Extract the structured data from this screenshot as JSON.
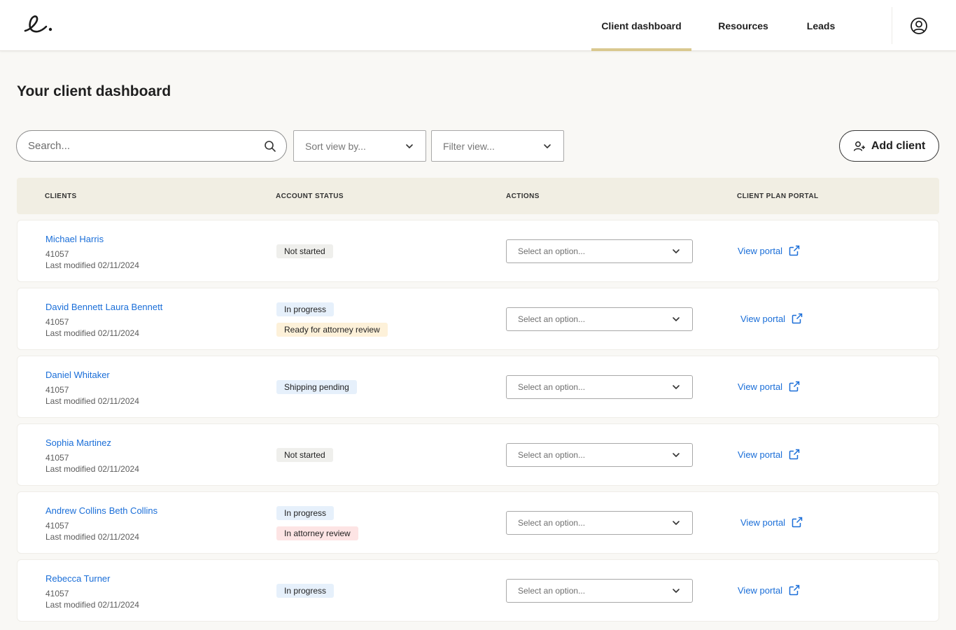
{
  "header": {
    "nav": [
      {
        "label": "Client dashboard",
        "active": true
      },
      {
        "label": "Resources",
        "active": false
      },
      {
        "label": "Leads",
        "active": false
      }
    ]
  },
  "page": {
    "title": "Your client dashboard"
  },
  "toolbar": {
    "search_placeholder": "Search...",
    "sort_placeholder": "Sort view by...",
    "filter_placeholder": "Filter view...",
    "add_client_label": "Add client"
  },
  "table": {
    "headers": [
      "CLIENTS",
      "ACCOUNT STATUS",
      "ACTIONS",
      "CLIENT PLAN PORTAL"
    ],
    "action_placeholder": "Select an option...",
    "portal_label": "View portal",
    "rows": [
      {
        "names": [
          "Michael Harris"
        ],
        "id": "41057",
        "modified": "Last modified 02/11/2024",
        "statuses": [
          {
            "label": "Not started",
            "tone": "gray"
          }
        ]
      },
      {
        "names": [
          "David Bennett",
          "Laura Bennett"
        ],
        "id": "41057",
        "modified": "Last modified 02/11/2024",
        "statuses": [
          {
            "label": "In progress",
            "tone": "blue"
          },
          {
            "label": "Ready for attorney review",
            "tone": "yellow"
          }
        ]
      },
      {
        "names": [
          "Daniel Whitaker"
        ],
        "id": "41057",
        "modified": "Last modified 02/11/2024",
        "statuses": [
          {
            "label": "Shipping pending",
            "tone": "blue"
          }
        ]
      },
      {
        "names": [
          "Sophia Martinez"
        ],
        "id": "41057",
        "modified": "Last modified 02/11/2024",
        "statuses": [
          {
            "label": "Not started",
            "tone": "gray"
          }
        ]
      },
      {
        "names": [
          "Andrew Collins",
          "Beth Collins"
        ],
        "id": "41057",
        "modified": "Last modified 02/11/2024",
        "statuses": [
          {
            "label": "In progress",
            "tone": "blue"
          },
          {
            "label": "In attorney review",
            "tone": "red"
          }
        ]
      },
      {
        "names": [
          "Rebecca Turner"
        ],
        "id": "41057",
        "modified": "Last modified 02/11/2024",
        "statuses": [
          {
            "label": "In progress",
            "tone": "blue"
          }
        ]
      }
    ]
  },
  "colors": {
    "link": "#1a6ed8",
    "accent": "#d9c88f",
    "header_band": "#f1eee3"
  },
  "icons": [
    "logo-mark",
    "user-circle-icon",
    "search-icon",
    "chevron-down-icon",
    "add-user-icon",
    "external-link-icon"
  ]
}
